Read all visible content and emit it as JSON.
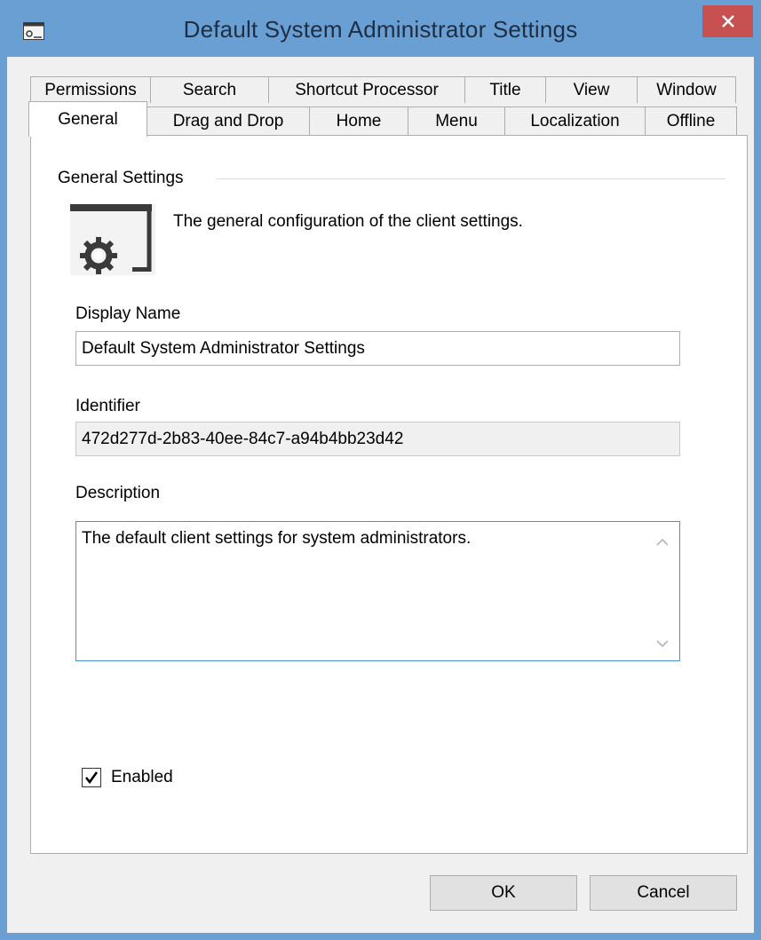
{
  "window": {
    "title": "Default System Administrator Settings",
    "accent_color": "#6a9fd3",
    "close_color": "#c75050",
    "app_icon": "settings-window-icon",
    "close_icon": "close-icon"
  },
  "tabs": {
    "row1": [
      {
        "label": "Permissions"
      },
      {
        "label": "Search"
      },
      {
        "label": "Shortcut Processor"
      },
      {
        "label": "Title"
      },
      {
        "label": "View"
      },
      {
        "label": "Window"
      }
    ],
    "row2": [
      {
        "label": "General",
        "active": true
      },
      {
        "label": "Drag and Drop"
      },
      {
        "label": "Home"
      },
      {
        "label": "Menu"
      },
      {
        "label": "Localization"
      },
      {
        "label": "Offline"
      }
    ]
  },
  "general": {
    "group_title": "General Settings",
    "icon": "settings-window-icon",
    "description": "The general configuration of the client settings.",
    "display_name_label": "Display Name",
    "display_name_value": "Default System Administrator Settings",
    "identifier_label": "Identifier",
    "identifier_value": "472d277d-2b83-40ee-84c7-a94b4bb23d42",
    "description_label": "Description",
    "description_value": "The default client settings for system administrators.",
    "enabled_label": "Enabled",
    "enabled_checked": true
  },
  "buttons": {
    "ok_label": "OK",
    "cancel_label": "Cancel"
  }
}
